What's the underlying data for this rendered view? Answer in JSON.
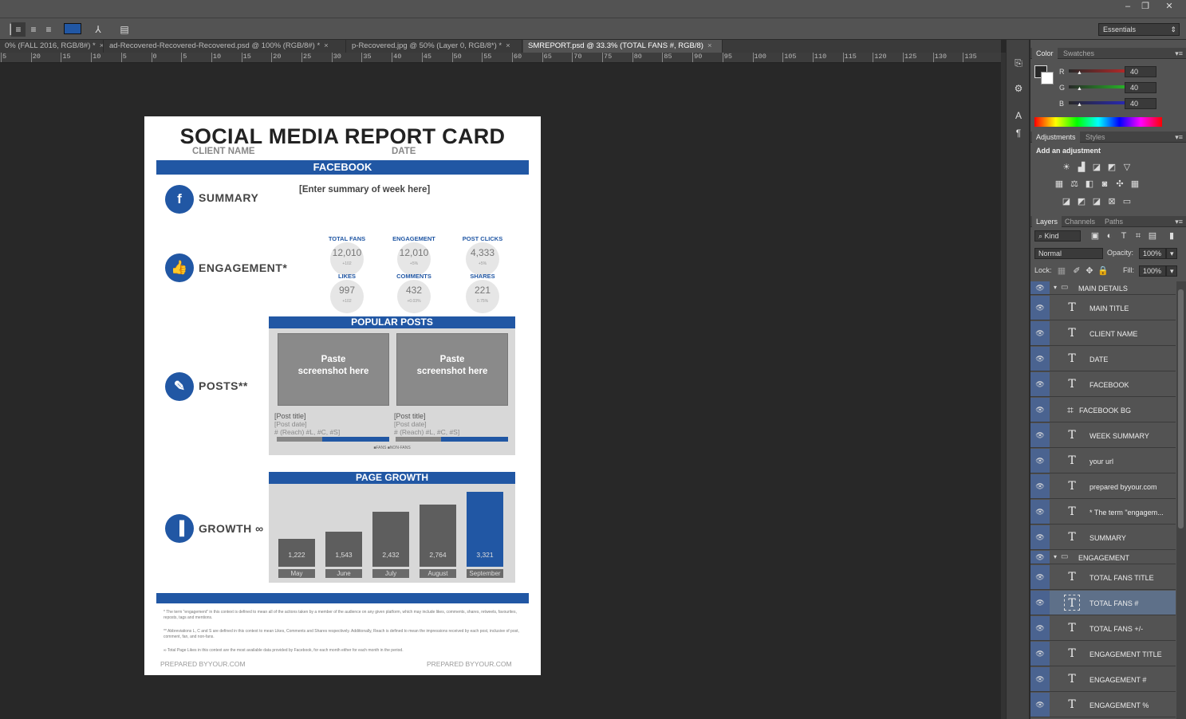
{
  "window": {
    "minimize": "–",
    "restore": "❐",
    "close": "✕"
  },
  "options": {
    "workspace": "Essentials"
  },
  "tabs": [
    {
      "label": "0% (FALL 2016, RGB/8#) *",
      "close": "×"
    },
    {
      "label": "ad-Recovered-Recovered-Recovered.psd @ 100% (RGB/8#) *",
      "close": "×"
    },
    {
      "label": "p-Recovered.jpg @ 50% (Layer 0, RGB/8*) *",
      "close": "×"
    },
    {
      "label": "SMREPORT.psd @ 33.3% (TOTAL FANS  #, RGB/8)",
      "close": "×"
    }
  ],
  "ruler": [
    "5",
    "20",
    "15",
    "10",
    "5",
    "0",
    "5",
    "10",
    "15",
    "20",
    "25",
    "30",
    "35",
    "40",
    "45",
    "50",
    "55",
    "60",
    "65",
    "70",
    "75",
    "80",
    "85",
    "90",
    "95",
    "100",
    "105",
    "110",
    "115",
    "120",
    "125",
    "130",
    "135"
  ],
  "document": {
    "title": "SOCIAL MEDIA REPORT CARD",
    "client_name": "CLIENT NAME",
    "date": "DATE",
    "facebook": "FACEBOOK",
    "summary_label": "SUMMARY",
    "summary_text": "[Enter summary of week here]",
    "engagement_label": "ENGAGEMENT*",
    "stats": [
      {
        "label": "TOTAL FANS",
        "value": "12,010",
        "sub": "+102"
      },
      {
        "label": "ENGAGEMENT",
        "value": "12,010",
        "sub": "+5%"
      },
      {
        "label": "POST CLICKS",
        "value": "4,333",
        "sub": "+5%"
      },
      {
        "label": "LIKES",
        "value": "997",
        "sub": "+102"
      },
      {
        "label": "COMMENTS",
        "value": "432",
        "sub": "+0.03%"
      },
      {
        "label": "SHARES",
        "value": "221",
        "sub": "0.75%"
      }
    ],
    "posts_label": "POSTS**",
    "popular_posts": "POPULAR POSTS",
    "screenshot_text_1": "Paste",
    "screenshot_text_2": "screenshot here",
    "post_title": "[Post title]",
    "post_date": "[Post date]",
    "post_reach": "# (Reach) #L, #C, #S]",
    "post_legend": "■FANS  ■NON-FANS",
    "growth_label": "GROWTH ∞",
    "page_growth": "PAGE GROWTH",
    "growth_chart": {
      "months": [
        "May",
        "June",
        "July",
        "August",
        "September"
      ],
      "values": [
        "1,222",
        "1,543",
        "2,432",
        "2,764",
        "3,321"
      ],
      "highlight_color": "#2157a4",
      "bar_color": "#5e5e5e"
    },
    "footnote_1": "* The term \"engagement\" in this context is defined to mean all of the actions taken by a member of the audience on any given platform, which may include likes, comments, shares, retweets, favourites, reposts, tags and mentions.",
    "footnote_2": "** Abbreviations L, C and S are defined in this context to mean Likes, Comments and Shares respectively. Additionally, Reach is defined to mean the impressions received by each post, inclusive of post, comment, fan, and non-fans.",
    "footnote_3": "∞ Total Page Likes in this context are the most available data provided by Facebook, for each month either for each month in the period.",
    "footer_left": "PREPARED BYYOUR.COM",
    "footer_right": "PREPARED BYYOUR.COM"
  },
  "color_panel": {
    "tabs": [
      "Color",
      "Swatches"
    ],
    "channels": [
      {
        "name": "R",
        "value": "40"
      },
      {
        "name": "G",
        "value": "40"
      },
      {
        "name": "B",
        "value": "40"
      }
    ]
  },
  "adjustments_panel": {
    "tabs": [
      "Adjustments",
      "Styles"
    ],
    "heading": "Add an adjustment"
  },
  "layers_panel": {
    "tabs": [
      "Layers",
      "Channels",
      "Paths"
    ],
    "kind": "Kind",
    "blend_mode": "Normal",
    "opacity_label": "Opacity:",
    "opacity": "100%",
    "lock_label": "Lock:",
    "fill_label": "Fill:",
    "fill": "100%",
    "layers": [
      {
        "name": "MAIN DETAILS",
        "type": "group"
      },
      {
        "name": "MAIN TITLE",
        "type": "text"
      },
      {
        "name": "CLIENT NAME",
        "type": "text"
      },
      {
        "name": "DATE",
        "type": "text"
      },
      {
        "name": "FACEBOOK",
        "type": "text"
      },
      {
        "name": "FACEBOOK BG",
        "type": "shape"
      },
      {
        "name": "WEEK SUMMARY",
        "type": "text"
      },
      {
        "name": "your url",
        "type": "text"
      },
      {
        "name": "prepared byyour.com",
        "type": "text"
      },
      {
        "name": "* The term \"engagem...",
        "type": "text"
      },
      {
        "name": "SUMMARY",
        "type": "text"
      },
      {
        "name": "ENGAGEMENT",
        "type": "group"
      },
      {
        "name": "TOTAL FANS TITLE",
        "type": "text"
      },
      {
        "name": "TOTAL FANS  #",
        "type": "text",
        "selected": true
      },
      {
        "name": "TOTAL FANS +/-",
        "type": "text"
      },
      {
        "name": "ENGAGEMENT TITLE",
        "type": "text"
      },
      {
        "name": "ENGAGEMENT #",
        "type": "text"
      },
      {
        "name": "ENGAGEMENT %",
        "type": "text"
      }
    ]
  }
}
